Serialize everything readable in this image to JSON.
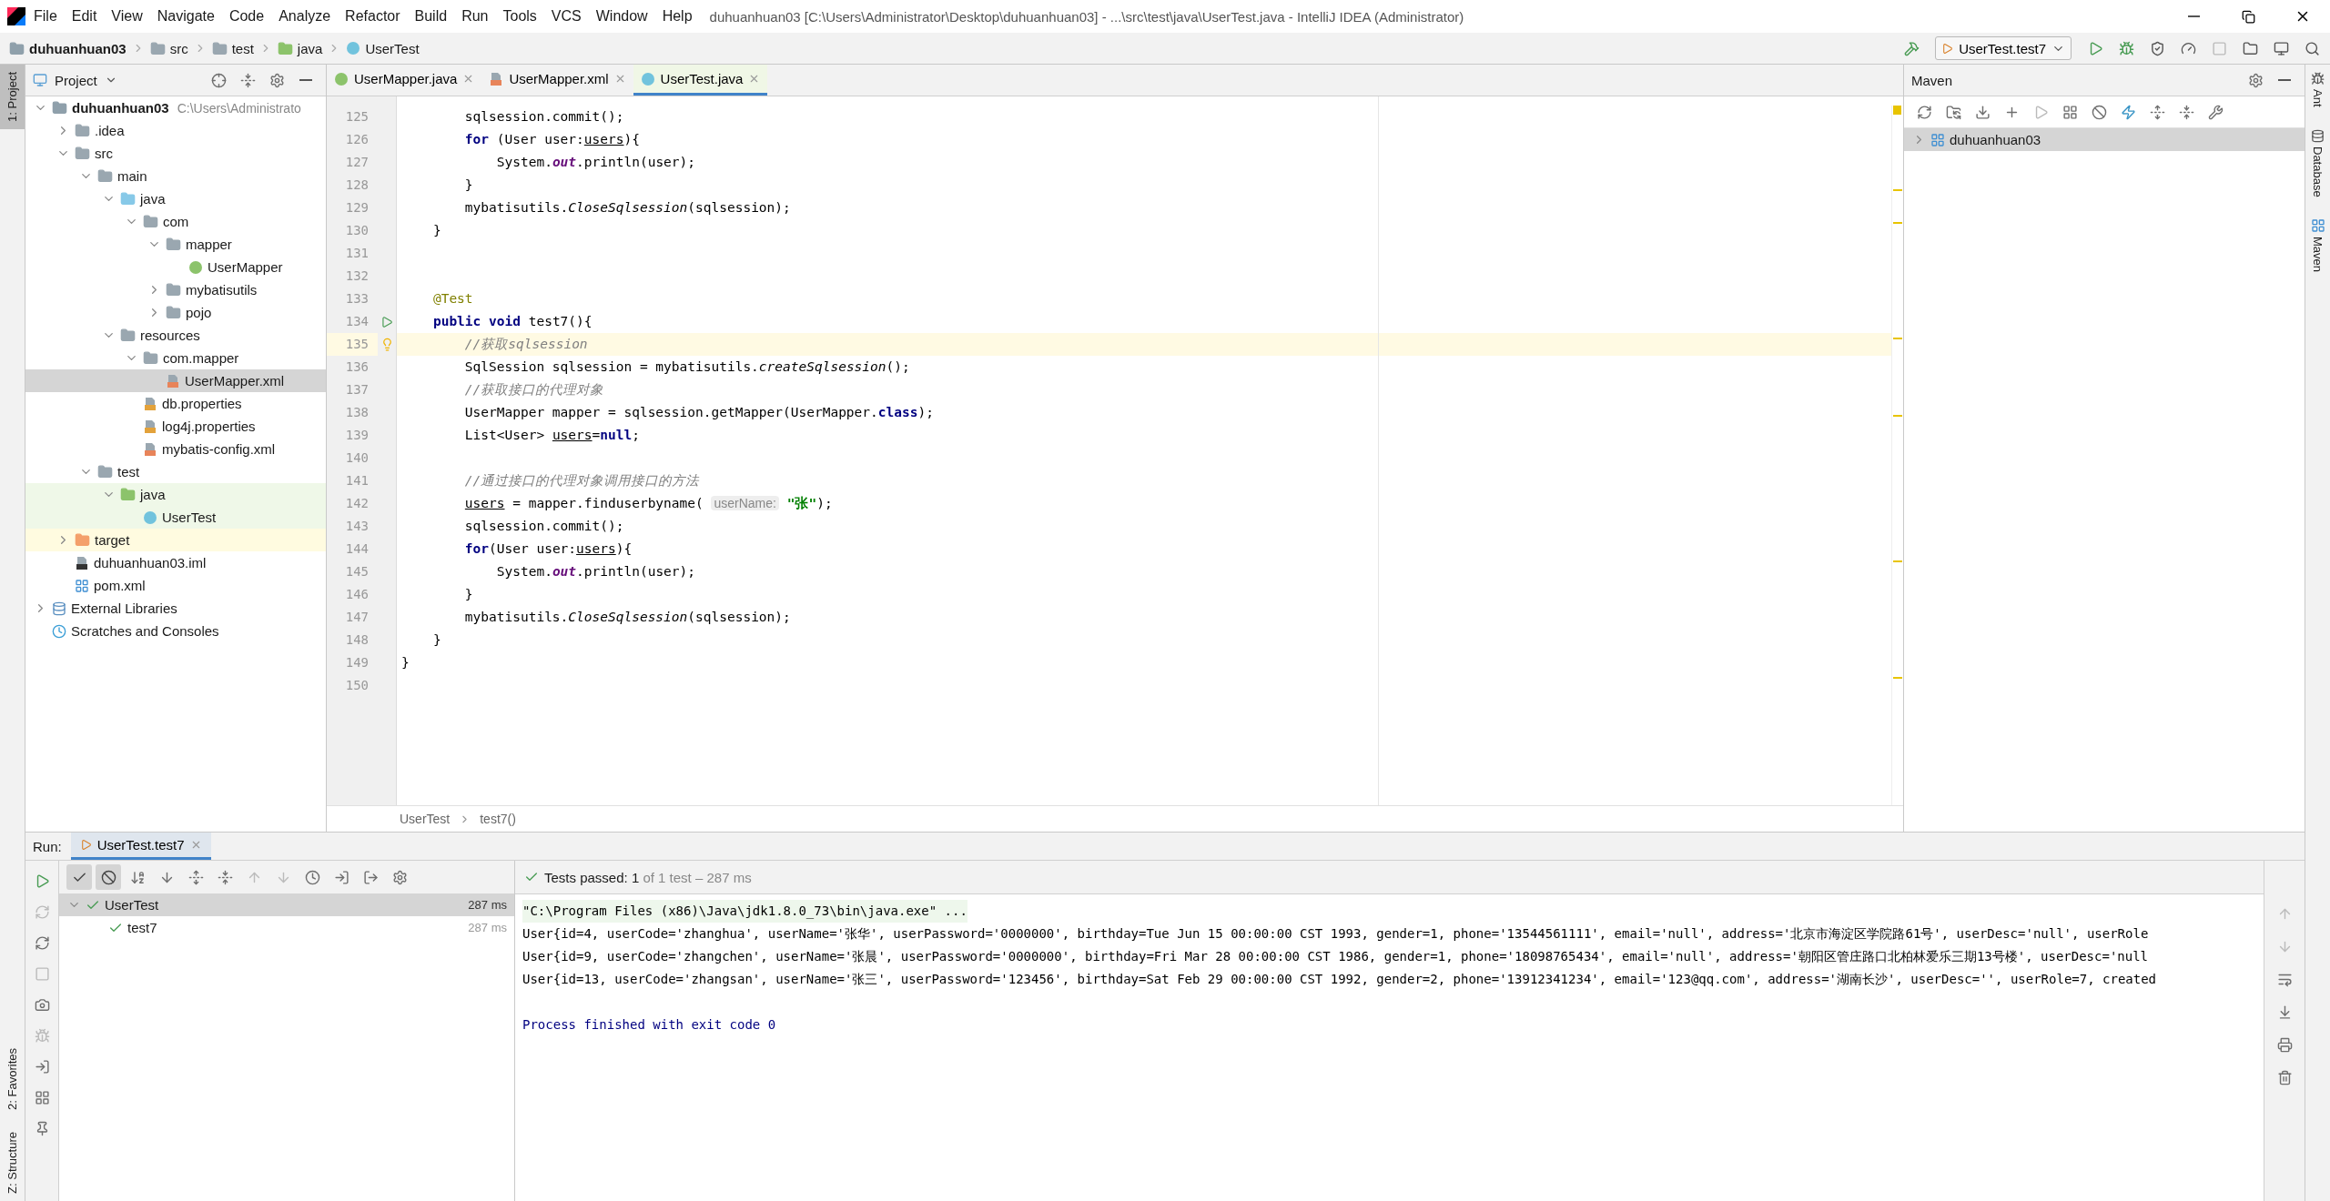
{
  "title_bar": {
    "menu": [
      "File",
      "Edit",
      "View",
      "Navigate",
      "Code",
      "Analyze",
      "Refactor",
      "Build",
      "Run",
      "Tools",
      "VCS",
      "Window",
      "Help"
    ],
    "title": "duhuanhuan03 [C:\\Users\\Administrator\\Desktop\\duhuanhuan03] - ...\\src\\test\\java\\UserTest.java - IntelliJ IDEA (Administrator)"
  },
  "nav_bar": {
    "breadcrumb": [
      {
        "label": "duhuanhuan03",
        "kind": "module"
      },
      {
        "label": "src",
        "kind": "folder"
      },
      {
        "label": "test",
        "kind": "folder"
      },
      {
        "label": "java",
        "kind": "test-folder"
      },
      {
        "label": "UserTest",
        "kind": "test-class"
      }
    ],
    "run_config": "UserTest.test7"
  },
  "left_stripe": {
    "top": [
      {
        "label": "1: Project",
        "selected": true
      }
    ],
    "bottom": [
      {
        "label": "2: Favorites",
        "selected": false
      },
      {
        "label": "Z: Structure",
        "selected": false
      }
    ]
  },
  "project": {
    "title": "Project",
    "tree": [
      {
        "label": "duhuanhuan03",
        "hint": "C:\\Users\\Administrato",
        "kind": "module",
        "expanded": true,
        "selected": false,
        "children": [
          {
            "label": ".idea",
            "kind": "folder",
            "expanded": false,
            "selected": false
          },
          {
            "label": "src",
            "kind": "folder",
            "expanded": true,
            "selected": false,
            "children": [
              {
                "label": "main",
                "kind": "folder",
                "expanded": true,
                "selected": false,
                "children": [
                  {
                    "label": "java",
                    "kind": "source-folder",
                    "expanded": true,
                    "selected": false,
                    "children": [
                      {
                        "label": "com",
                        "kind": "package",
                        "expanded": true,
                        "selected": false,
                        "children": [
                          {
                            "label": "mapper",
                            "kind": "package",
                            "expanded": true,
                            "selected": false,
                            "children": [
                              {
                                "label": "UserMapper",
                                "kind": "interface",
                                "selected": false
                              }
                            ]
                          },
                          {
                            "label": "mybatisutils",
                            "kind": "package",
                            "expanded": false,
                            "selected": false
                          },
                          {
                            "label": "pojo",
                            "kind": "package",
                            "expanded": false,
                            "selected": false
                          }
                        ]
                      }
                    ]
                  },
                  {
                    "label": "resources",
                    "kind": "resources",
                    "expanded": true,
                    "selected": false,
                    "children": [
                      {
                        "label": "com.mapper",
                        "kind": "folder",
                        "expanded": true,
                        "selected": false,
                        "children": [
                          {
                            "label": "UserMapper.xml",
                            "kind": "xml",
                            "selected": true
                          }
                        ]
                      },
                      {
                        "label": "db.properties",
                        "kind": "properties",
                        "selected": false
                      },
                      {
                        "label": "log4j.properties",
                        "kind": "properties",
                        "selected": false
                      },
                      {
                        "label": "mybatis-config.xml",
                        "kind": "xml",
                        "selected": false
                      }
                    ]
                  }
                ]
              },
              {
                "label": "test",
                "kind": "folder",
                "expanded": true,
                "selected": false,
                "children": [
                  {
                    "label": "java",
                    "kind": "test-folder",
                    "expanded": true,
                    "selected": false,
                    "test_source": true,
                    "children": [
                      {
                        "label": "UserTest",
                        "kind": "test-class",
                        "selected": false,
                        "test_source": true
                      }
                    ]
                  }
                ]
              }
            ]
          },
          {
            "label": "target",
            "kind": "excluded-folder",
            "expanded": false,
            "selected": false,
            "excluded": true
          },
          {
            "label": "duhuanhuan03.iml",
            "kind": "iml",
            "selected": false
          },
          {
            "label": "pom.xml",
            "kind": "maven",
            "selected": false
          }
        ]
      },
      {
        "label": "External Libraries",
        "kind": "libraries",
        "expanded": false,
        "selected": false
      },
      {
        "label": "Scratches and Consoles",
        "kind": "scratches",
        "selected": false
      }
    ]
  },
  "editor": {
    "tabs": [
      {
        "label": "UserMapper.java",
        "kind": "interface",
        "selected": false
      },
      {
        "label": "UserMapper.xml",
        "kind": "xml",
        "selected": false
      },
      {
        "label": "UserTest.java",
        "kind": "test-class",
        "selected": true
      }
    ],
    "lines": [
      {
        "number": "125",
        "current": false,
        "tokens": [
          {
            "kind": "plain",
            "text": "        sqlsession.commit();"
          }
        ]
      },
      {
        "number": "126",
        "current": false,
        "tokens": [
          {
            "kind": "keyword",
            "text": "        for"
          },
          {
            "kind": "plain",
            "text": " (User user:"
          },
          {
            "kind": "var",
            "text": "users"
          },
          {
            "kind": "plain",
            "text": "){"
          }
        ]
      },
      {
        "number": "127",
        "current": false,
        "tokens": [
          {
            "kind": "plain",
            "text": "            System."
          },
          {
            "kind": "field",
            "text": "out"
          },
          {
            "kind": "plain",
            "text": ".println(user);"
          }
        ]
      },
      {
        "number": "128",
        "current": false,
        "tokens": [
          {
            "kind": "plain",
            "text": "        }"
          }
        ]
      },
      {
        "number": "129",
        "current": false,
        "tokens": [
          {
            "kind": "plain",
            "text": "        mybatisutils."
          },
          {
            "kind": "static",
            "text": "CloseSqlsession"
          },
          {
            "kind": "plain",
            "text": "(sqlsession);"
          }
        ]
      },
      {
        "number": "130",
        "current": false,
        "tokens": [
          {
            "kind": "plain",
            "text": "    }"
          }
        ]
      },
      {
        "number": "131",
        "current": false
      },
      {
        "number": "132",
        "current": false
      },
      {
        "number": "133",
        "current": false,
        "tokens": [
          {
            "kind": "annotation",
            "text": "    @Test"
          }
        ]
      },
      {
        "number": "134",
        "current": false,
        "kind": "run",
        "tokens": [
          {
            "kind": "keyword",
            "text": "    public void"
          },
          {
            "kind": "plain",
            "text": " test7(){"
          }
        ]
      },
      {
        "number": "135",
        "current": true,
        "kind": "bulb",
        "tokens": [
          {
            "kind": "comment",
            "text": "        //获取sqlsession"
          }
        ]
      },
      {
        "number": "136",
        "current": false,
        "tokens": [
          {
            "kind": "plain",
            "text": "        SqlSession sqlsession = mybatisutils."
          },
          {
            "kind": "static",
            "text": "createSqlsession"
          },
          {
            "kind": "plain",
            "text": "();"
          }
        ]
      },
      {
        "number": "137",
        "current": false,
        "tokens": [
          {
            "kind": "comment",
            "text": "        //获取接口的代理对象"
          }
        ]
      },
      {
        "number": "138",
        "current": false,
        "tokens": [
          {
            "kind": "plain",
            "text": "        UserMapper mapper = sqlsession.getMapper(UserMapper."
          },
          {
            "kind": "keyword",
            "text": "class"
          },
          {
            "kind": "plain",
            "text": ");"
          }
        ]
      },
      {
        "number": "139",
        "current": false,
        "tokens": [
          {
            "kind": "plain",
            "text": "        List<User> "
          },
          {
            "kind": "var",
            "text": "users"
          },
          {
            "kind": "plain",
            "text": "="
          },
          {
            "kind": "keyword",
            "text": "null"
          },
          {
            "kind": "plain",
            "text": ";"
          }
        ]
      },
      {
        "number": "140",
        "current": false
      },
      {
        "number": "141",
        "current": false,
        "tokens": [
          {
            "kind": "comment",
            "text": "        //通过接口的代理对象调用接口的方法"
          }
        ]
      },
      {
        "number": "142",
        "current": false,
        "tokens": [
          {
            "kind": "var",
            "text": "        users"
          },
          {
            "kind": "plain",
            "text": " = mapper.finduserbyname( "
          },
          {
            "kind": "hint",
            "text": "userName:"
          },
          {
            "kind": "string",
            "text": " \"张\""
          },
          {
            "kind": "plain",
            "text": ");"
          }
        ]
      },
      {
        "number": "143",
        "current": false,
        "tokens": [
          {
            "kind": "plain",
            "text": "        sqlsession.commit();"
          }
        ]
      },
      {
        "number": "144",
        "current": false,
        "tokens": [
          {
            "kind": "keyword",
            "text": "        for"
          },
          {
            "kind": "plain",
            "text": "(User user:"
          },
          {
            "kind": "var",
            "text": "users"
          },
          {
            "kind": "plain",
            "text": "){"
          }
        ]
      },
      {
        "number": "145",
        "current": false,
        "tokens": [
          {
            "kind": "plain",
            "text": "            System."
          },
          {
            "kind": "field",
            "text": "out"
          },
          {
            "kind": "plain",
            "text": ".println(user);"
          }
        ]
      },
      {
        "number": "146",
        "current": false,
        "tokens": [
          {
            "kind": "plain",
            "text": "        }"
          }
        ]
      },
      {
        "number": "147",
        "current": false,
        "tokens": [
          {
            "kind": "plain",
            "text": "        mybatisutils."
          },
          {
            "kind": "static",
            "text": "CloseSqlsession"
          },
          {
            "kind": "plain",
            "text": "(sqlsession);"
          }
        ]
      },
      {
        "number": "148",
        "current": false,
        "tokens": [
          {
            "kind": "plain",
            "text": "    }"
          }
        ]
      },
      {
        "number": "149",
        "current": false,
        "tokens": [
          {
            "kind": "plain",
            "text": "}"
          }
        ]
      },
      {
        "number": "150",
        "current": false
      }
    ],
    "breadcrumb": [
      "UserTest",
      "test7()"
    ]
  },
  "maven": {
    "title": "Maven",
    "tree": [
      {
        "label": "duhuanhuan03",
        "kind": "maven",
        "expanded": false,
        "selected": true
      }
    ]
  },
  "right_stripe": [
    {
      "label": "Ant",
      "kind": "ant"
    },
    {
      "label": "Database",
      "kind": "database"
    },
    {
      "label": "Maven",
      "kind": "maven"
    }
  ],
  "run": {
    "label": "Run:",
    "tab": "UserTest.test7",
    "status_main": "Tests passed: 1",
    "status_detail": "of 1 test – 287 ms",
    "tests": [
      {
        "label": "UserTest",
        "time": "287 ms",
        "selected": true,
        "expanded": true,
        "children": [
          {
            "label": "test7",
            "time": "287 ms",
            "selected": false
          }
        ]
      }
    ],
    "console": [
      {
        "kind": "command",
        "text": "\"C:\\Program Files (x86)\\Java\\jdk1.8.0_73\\bin\\java.exe\" ..."
      },
      {
        "kind": "output",
        "text": "User{id=4, userCode='zhanghua', userName='张华', userPassword='0000000', birthday=Tue Jun 15 00:00:00 CST 1993, gender=1, phone='13544561111', email='null', address='北京市海淀区学院路61号', userDesc='null', userRole"
      },
      {
        "kind": "output",
        "text": "User{id=9, userCode='zhangchen', userName='张晨', userPassword='0000000', birthday=Fri Mar 28 00:00:00 CST 1986, gender=1, phone='18098765434', email='null', address='朝阳区管庄路口北柏林爱乐三期13号楼', userDesc='null"
      },
      {
        "kind": "output",
        "text": "User{id=13, userCode='zhangsan', userName='张三', userPassword='123456', birthday=Sat Feb 29 00:00:00 CST 1992, gender=2, phone='13912341234', email='123@qq.com', address='湖南长沙', userDesc='', userRole=7, created"
      },
      {
        "kind": "exit",
        "text": "Process finished with exit code 0"
      }
    ]
  }
}
